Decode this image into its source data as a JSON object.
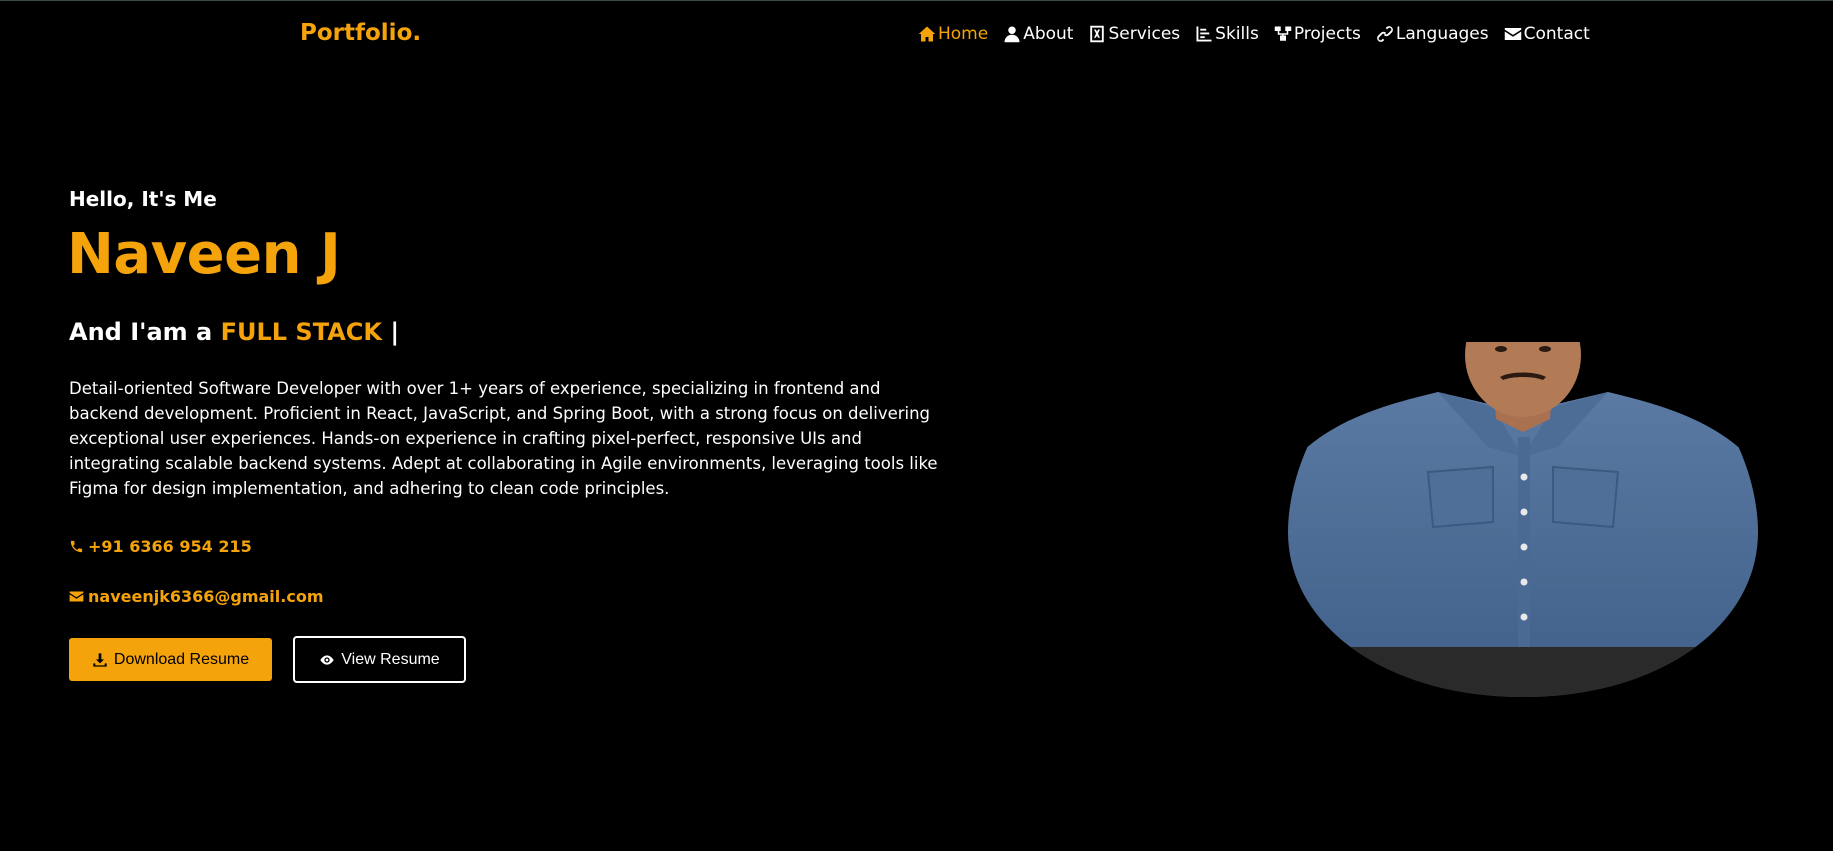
{
  "header": {
    "logo": "Portfolio.",
    "nav": [
      {
        "label": "Home",
        "icon": "home-icon",
        "active": true
      },
      {
        "label": "About",
        "icon": "user-icon",
        "active": false
      },
      {
        "label": "Services",
        "icon": "services-icon",
        "active": false
      },
      {
        "label": "Skills",
        "icon": "chart-icon",
        "active": false
      },
      {
        "label": "Projects",
        "icon": "sitemap-icon",
        "active": false
      },
      {
        "label": "Languages",
        "icon": "link-icon",
        "active": false
      },
      {
        "label": "Contact",
        "icon": "envelope-icon",
        "active": false
      }
    ]
  },
  "hero": {
    "greeting": "Hello, It's Me",
    "name": "Naveen J",
    "role_prefix": "And I'am a",
    "role_highlight": "FULL STACK",
    "role_cursor": "|",
    "bio": "Detail-oriented Software Developer with over 1+ years of experience, specializing in frontend and backend development. Proficient in React, JavaScript, and Spring Boot, with a strong focus on delivering exceptional user experiences. Hands-on experience in crafting pixel-perfect, responsive UIs and integrating scalable backend systems. Adept at collaborating in Agile environments, leveraging tools like Figma for design implementation, and adhering to clean code principles.",
    "phone": "+91 6366 954 215",
    "email": "naveenjk6366@gmail.com",
    "download_label": "Download Resume",
    "view_label": "View Resume"
  },
  "colors": {
    "accent": "#f5a30b",
    "background": "#000000",
    "text": "#ffffff"
  }
}
